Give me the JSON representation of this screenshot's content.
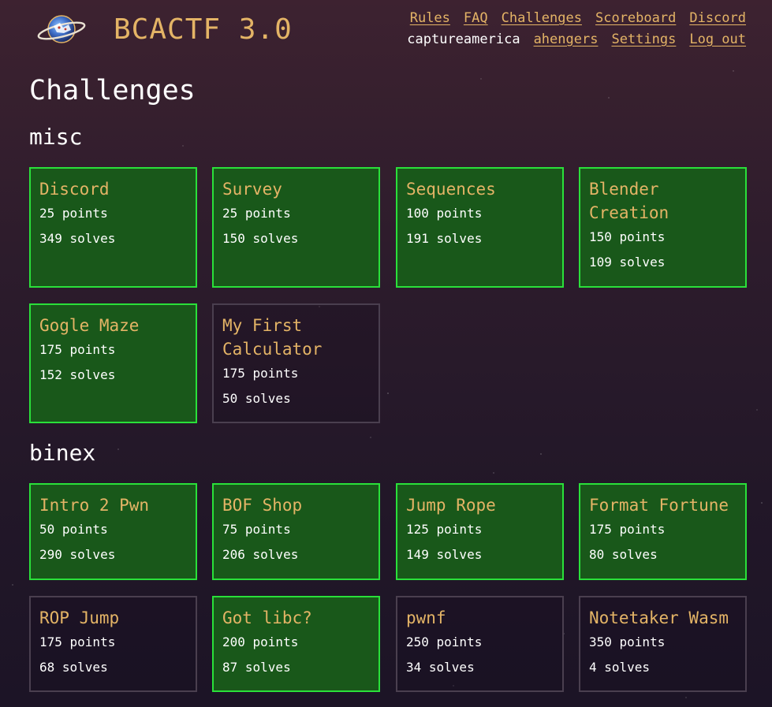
{
  "site": {
    "title": "BCACTF 3.0"
  },
  "nav": {
    "links": [
      "Rules",
      "FAQ",
      "Challenges",
      "Scoreboard",
      "Discord"
    ],
    "username": "captureamerica",
    "team": "ahengers",
    "settings": "Settings",
    "logout": "Log out"
  },
  "page": {
    "title": "Challenges"
  },
  "colors": {
    "accent": "#e4b466",
    "solved_border": "#2ae03a",
    "solved_background": "#19581a",
    "unsolved_border": "#4a3f4f"
  },
  "icons": {
    "logo": "bcactf-planet-logo"
  },
  "categories": [
    {
      "name": "misc",
      "challenges": [
        {
          "name": "Discord",
          "points": "25 points",
          "solves": "349 solves",
          "solved": true
        },
        {
          "name": "Survey",
          "points": "25 points",
          "solves": "150 solves",
          "solved": true
        },
        {
          "name": "Sequences",
          "points": "100 points",
          "solves": "191 solves",
          "solved": true
        },
        {
          "name": "Blender Creation",
          "points": "150 points",
          "solves": "109 solves",
          "solved": true
        },
        {
          "name": "Gogle Maze",
          "points": "175 points",
          "solves": "152 solves",
          "solved": true
        },
        {
          "name": "My First Calculator",
          "points": "175 points",
          "solves": "50 solves",
          "solved": false
        }
      ]
    },
    {
      "name": "binex",
      "challenges": [
        {
          "name": "Intro 2 Pwn",
          "points": "50 points",
          "solves": "290 solves",
          "solved": true
        },
        {
          "name": "BOF Shop",
          "points": "75 points",
          "solves": "206 solves",
          "solved": true
        },
        {
          "name": "Jump Rope",
          "points": "125 points",
          "solves": "149 solves",
          "solved": true
        },
        {
          "name": "Format Fortune",
          "points": "175 points",
          "solves": "80 solves",
          "solved": true
        },
        {
          "name": "ROP Jump",
          "points": "175 points",
          "solves": "68 solves",
          "solved": false
        },
        {
          "name": "Got libc?",
          "points": "200 points",
          "solves": "87 solves",
          "solved": true
        },
        {
          "name": "pwnf",
          "points": "250 points",
          "solves": "34 solves",
          "solved": false
        },
        {
          "name": "Notetaker Wasm",
          "points": "350 points",
          "solves": "4 solves",
          "solved": false
        }
      ]
    }
  ]
}
